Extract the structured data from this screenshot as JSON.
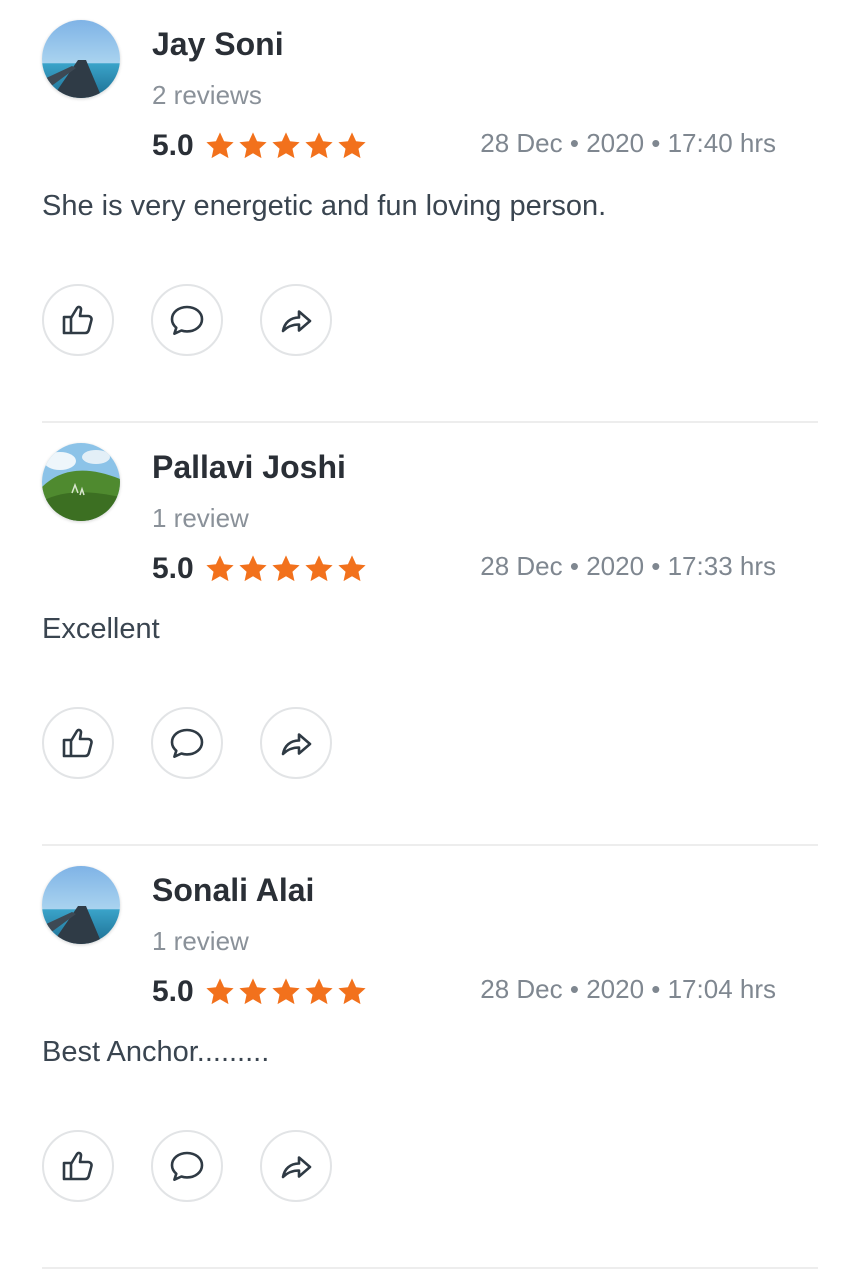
{
  "accent": "#f2711c",
  "reviews": [
    {
      "name": "Jay Soni",
      "count": "2 reviews",
      "rating": "5.0",
      "stars": 5,
      "date": "28 Dec • 2020 • 17:40 hrs",
      "text": "She is very energetic and fun loving person.",
      "avatar": "sea-pier-photo"
    },
    {
      "name": "Pallavi Joshi",
      "count": "1 review",
      "rating": "5.0",
      "stars": 5,
      "date": "28 Dec • 2020 • 17:33 hrs",
      "text": "Excellent",
      "avatar": "green-hill-photo"
    },
    {
      "name": "Sonali Alai",
      "count": "1 review",
      "rating": "5.0",
      "stars": 5,
      "date": "28 Dec • 2020 • 17:04 hrs",
      "text": "Best Anchor.........",
      "avatar": "sea-pier-photo"
    }
  ],
  "icons": {
    "like": "thumbs-up-icon",
    "comment": "comment-icon",
    "share": "share-icon",
    "star": "star-icon"
  }
}
